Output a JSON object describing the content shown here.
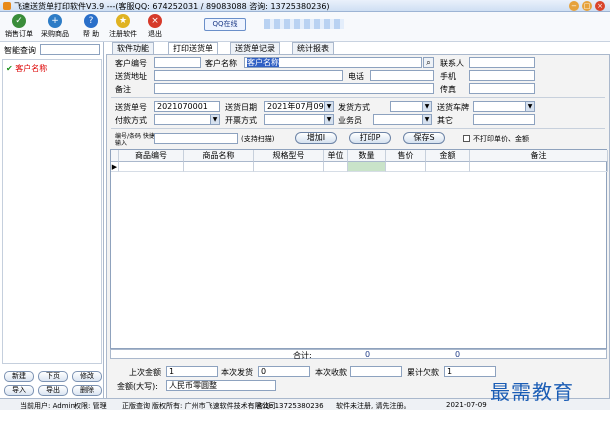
{
  "window": {
    "title": "飞速送货单打印软件V3.9 ---(客服QQ: 674252031 / 89083088 咨询: 13725380236)"
  },
  "toolbar": {
    "sales": "销售订单",
    "purchase": "采购商品",
    "help": "帮 助",
    "register": "注册软件",
    "exit": "退出",
    "qq": "QQ在线"
  },
  "left": {
    "smart_label": "智能查询",
    "tree_root": "客户名称",
    "buttons": {
      "add": "新建",
      "next": "下页",
      "modify": "修改",
      "import": "导入",
      "export": "导出",
      "delete": "删除"
    }
  },
  "tabs": [
    "软件功能",
    "打印送货单",
    "送货单记录",
    "统计报表"
  ],
  "form": {
    "cust_no_label": "客户编号",
    "cust_name_label": "客户名称",
    "cust_name_value": "客户名称",
    "contact_label": "联系人",
    "addr_label": "送货地址",
    "phone_label": "电话",
    "mobile_label": "手机",
    "note_label": "备注",
    "fax_label": "传真",
    "order_no_label": "送货单号",
    "order_no_value": "2021070001",
    "date_label": "送货日期",
    "date_value": "2021年07月09日",
    "ship_label": "发货方式",
    "plate_label": "送货车牌",
    "pay_label": "付款方式",
    "invoice_label": "开票方式",
    "salesman_label": "业务员",
    "other_label": "其它",
    "code_label": "编号/条码 快捷输入",
    "scan_hint": "(支持扫描)",
    "add_btn": "增加I",
    "print_btn": "打印P",
    "save_btn": "保存S",
    "noprint_label": "不打印单价、金额"
  },
  "grid": {
    "headers": [
      "商品编号",
      "商品名称",
      "规格型号",
      "单位",
      "数量",
      "售价",
      "金额",
      "备注"
    ]
  },
  "summary": {
    "total_label": "合计:",
    "total_qty": "0",
    "total_amount": "0",
    "last_amount_label": "上次金额",
    "last_amount_value": "1",
    "this_ship_label": "本次发货",
    "this_ship_value": "0",
    "this_recv_label": "本次收款",
    "owed_label": "累计欠款",
    "owed_value": "1",
    "upper_label": "金额(大写):",
    "upper_value": "人民币零圆整"
  },
  "status": {
    "user": "当前用户: Admin",
    "role": "权限: 管理",
    "edition": "正版查询",
    "copyright": "版权所有: 广州市飞速软件技术有限公司",
    "phone": "咨询: 13725380236",
    "reg": "软件未注册, 请先注册。",
    "date": "2021-07-09"
  },
  "watermark": "最需教育"
}
